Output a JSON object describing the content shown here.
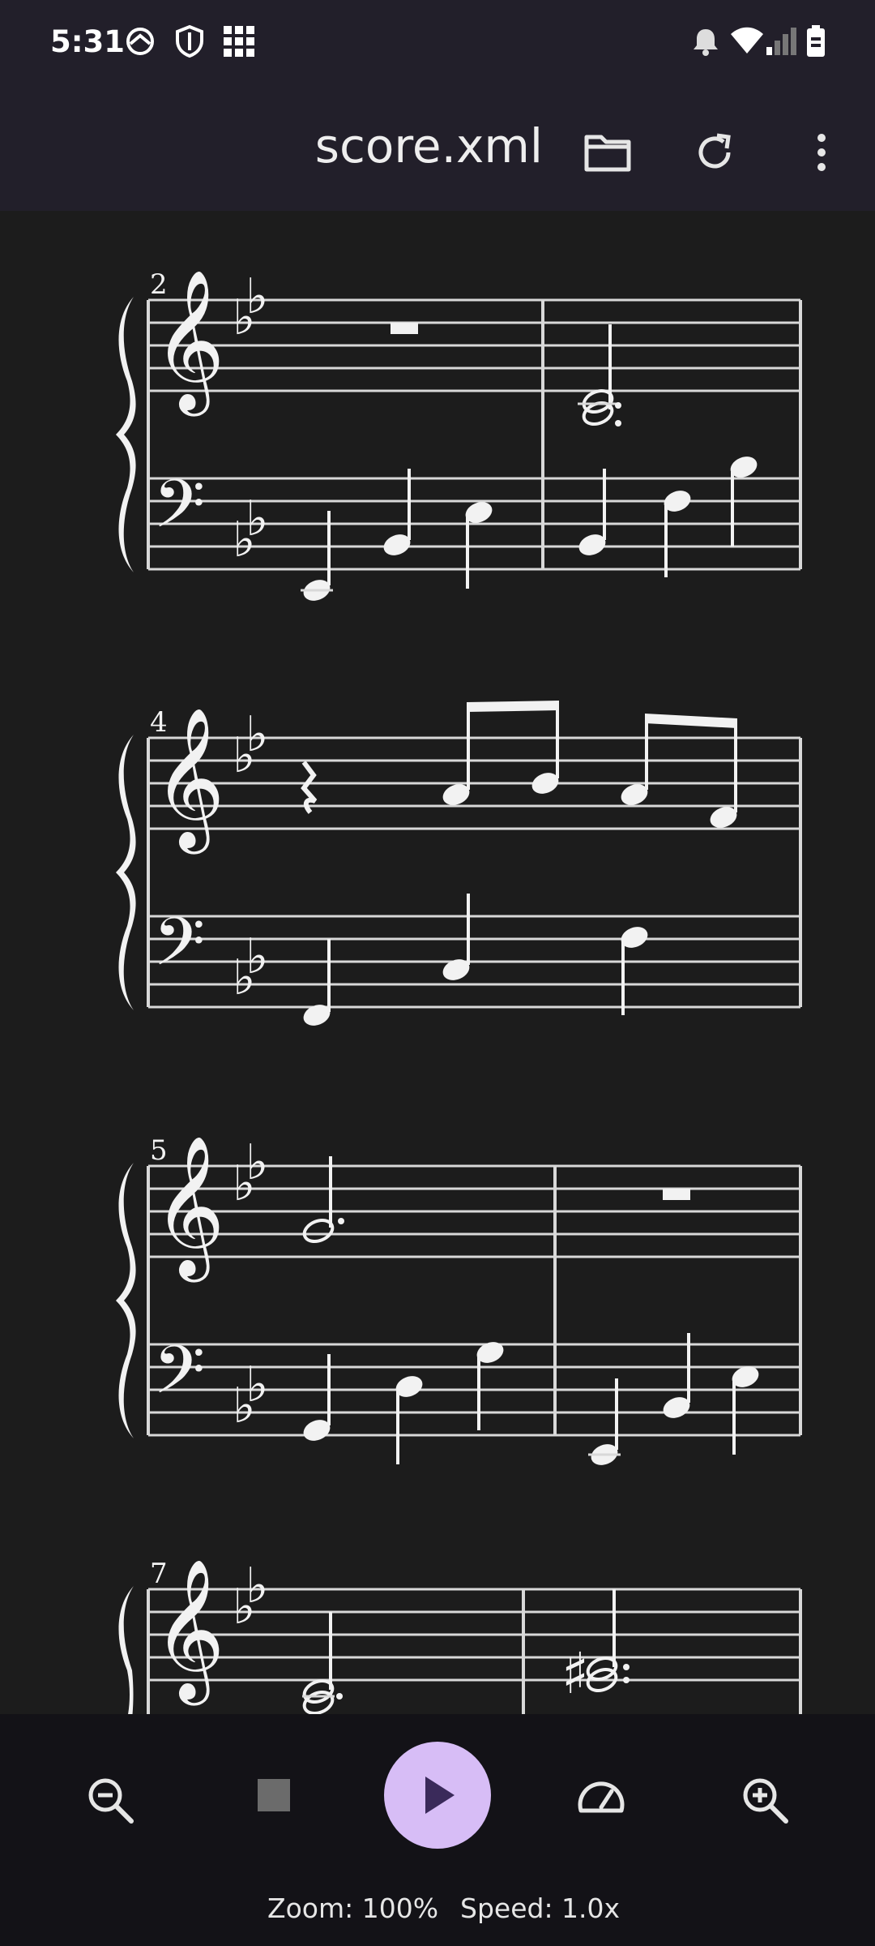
{
  "status_bar": {
    "time": "5:31",
    "left_icons": [
      "sync-icon",
      "shield-icon",
      "grid-icon"
    ],
    "right_icons": [
      "alarm-icon",
      "wifi-icon",
      "signal-icon",
      "battery-icon"
    ]
  },
  "app_bar": {
    "title": "score.xml",
    "actions": [
      "folder-icon",
      "refresh-icon",
      "more-vert-icon"
    ]
  },
  "score": {
    "measure_numbers": [
      "2",
      "4",
      "5",
      "7"
    ],
    "key_signature": "B-flat major (2 flats)",
    "clefs": [
      "treble",
      "bass"
    ]
  },
  "controls": {
    "buttons": [
      "zoom-out-icon",
      "stop-icon",
      "play-icon",
      "speed-icon",
      "zoom-in-icon"
    ],
    "zoom_text": "Zoom: 100%",
    "speed_text": "Speed: 1.0x"
  },
  "colors": {
    "app_bar": "#221f2a",
    "background": "#1c1c1c",
    "bottom_bar": "#131217",
    "play_button": "#d7bdf6",
    "play_icon": "#3a2a5a",
    "stop_icon": "#6b6b6b",
    "notation": "#f2f2f2"
  }
}
